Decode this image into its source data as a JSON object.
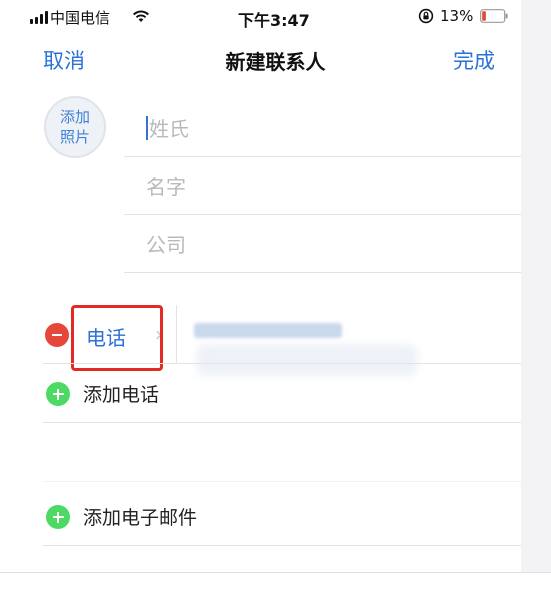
{
  "status_bar": {
    "carrier": "中国电信",
    "time": "下午3:47",
    "battery_percent": "13%",
    "battery_level": 0.13,
    "icons": [
      "signal-icon",
      "wifi-icon",
      "orientation-lock-icon",
      "battery-icon"
    ]
  },
  "nav": {
    "cancel_label": "取消",
    "title": "新建联系人",
    "done_label": "完成"
  },
  "photo": {
    "line1": "添加",
    "line2": "照片"
  },
  "fields": {
    "last_name_placeholder": "姓氏",
    "first_name_placeholder": "名字",
    "company_placeholder": "公司"
  },
  "phone": {
    "label": "电话",
    "chevron": "›"
  },
  "actions": {
    "add_phone": "添加电话",
    "add_email": "添加电子邮件"
  },
  "colors": {
    "accent": "#2a72d6",
    "delete": "#e7473b",
    "add": "#4cd964",
    "highlight": "#e42a24"
  }
}
